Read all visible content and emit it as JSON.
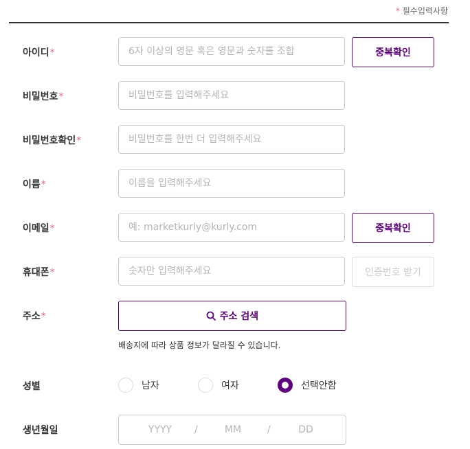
{
  "required_note": {
    "star": "*",
    "text": " 필수입력사항"
  },
  "required_star": "*",
  "fields": {
    "id": {
      "label": "아이디",
      "placeholder": "6자 이상의 영문 혹은 영문과 숫자를 조합",
      "button": "중복확인"
    },
    "password": {
      "label": "비밀번호",
      "placeholder": "비밀번호를 입력해주세요"
    },
    "password_confirm": {
      "label": "비밀번호확인",
      "placeholder": "비밀번호를 한번 더 입력해주세요"
    },
    "name": {
      "label": "이름",
      "placeholder": "이름을 입력해주세요"
    },
    "email": {
      "label": "이메일",
      "placeholder": "예: marketkurly@kurly.com",
      "button": "중복확인"
    },
    "phone": {
      "label": "휴대폰",
      "placeholder": "숫자만 입력해주세요",
      "button": "인증번호 받기"
    },
    "address": {
      "label": "주소",
      "button": "주소 검색",
      "note": "배송지에 따라 상품 정보가 달라질 수 있습니다."
    },
    "gender": {
      "label": "성별",
      "options": [
        "남자",
        "여자",
        "선택안함"
      ],
      "selected": "선택안함"
    },
    "birth": {
      "label": "생년월일",
      "year": "YYYY",
      "month": "MM",
      "day": "DD",
      "separator": "/"
    }
  },
  "colors": {
    "accent": "#5f0080",
    "required": "#ee6a7b",
    "border": "#cccccc",
    "placeholder": "#b5b5b5"
  },
  "icons": {
    "address_search": "search-icon"
  }
}
